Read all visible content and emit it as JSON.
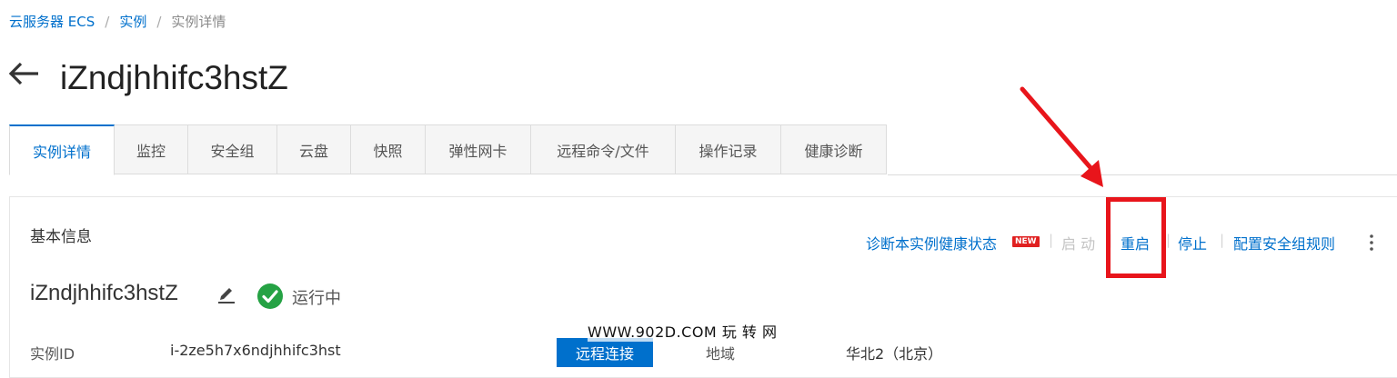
{
  "breadcrumb": {
    "items": [
      "云服务器 ECS",
      "实例",
      "实例详情"
    ],
    "separator": "/"
  },
  "header": {
    "back_icon": "arrow-left-icon",
    "title": "iZndjhhifc3hstZ"
  },
  "tabs": [
    {
      "label": "实例详情",
      "active": true
    },
    {
      "label": "监控"
    },
    {
      "label": "安全组"
    },
    {
      "label": "云盘"
    },
    {
      "label": "快照"
    },
    {
      "label": "弹性网卡"
    },
    {
      "label": "远程命令/文件"
    },
    {
      "label": "操作记录"
    },
    {
      "label": "健康诊断"
    }
  ],
  "basic_info": {
    "section_title": "基本信息",
    "actions": {
      "diagnose": "诊断本实例健康状态",
      "new_badge": "NEW",
      "start": "启 动",
      "restart": "重启",
      "stop": "停止",
      "config_security": "配置安全组规则",
      "more_icon": "more-vertical-icon"
    },
    "instance_name": "iZndjhhifc3hstZ",
    "status": "运行中",
    "instance_id_label": "实例ID",
    "instance_id": "i-2ze5h7x6ndjhhifc3hst",
    "remote_connect": "远程连接",
    "region_label": "地域",
    "region": "华北2（北京）"
  },
  "watermark": "WWW.902D.COM 玩 转 网",
  "colors": {
    "link": "#0070cc",
    "annotation_red": "#e8151b",
    "status_green": "#25a244",
    "badge_red": "#e02020"
  }
}
